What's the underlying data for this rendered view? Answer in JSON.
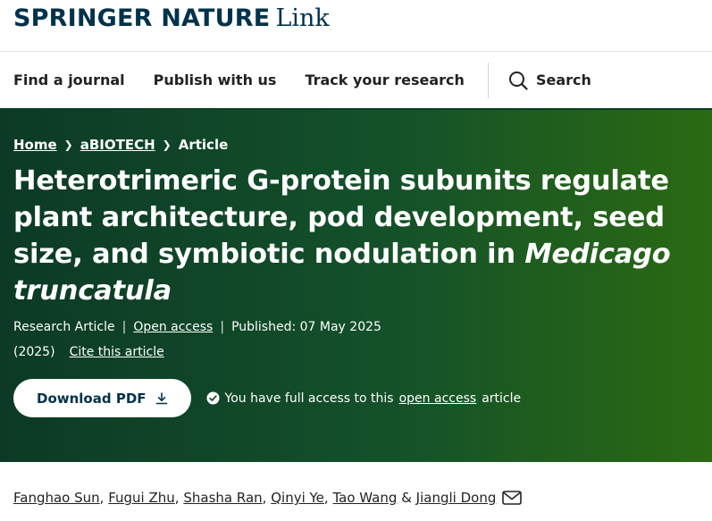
{
  "brand": {
    "main": "SPRINGER NATURE",
    "sub": "Link"
  },
  "nav": {
    "items": [
      "Find a journal",
      "Publish with us",
      "Track your research"
    ],
    "search_label": "Search"
  },
  "breadcrumb": {
    "home": "Home",
    "journal": "aBIOTECH",
    "current": "Article"
  },
  "article": {
    "title_main": "Heterotrimeric G-protein subunits regulate plant architecture, pod development, seed size, and symbiotic nodulation in ",
    "title_species": "Medicago truncatula",
    "type": "Research Article",
    "open_access": "Open access",
    "published": "Published: 07 May 2025",
    "year": "(2025)",
    "cite": "Cite this article"
  },
  "download": {
    "label": "Download PDF"
  },
  "access": {
    "prefix": "You have full access to this",
    "link": "open access",
    "suffix": "article"
  },
  "authors": {
    "names": [
      "Fanghao Sun",
      "Fugui Zhu",
      "Shasha Ran",
      "Qinyi Ye",
      "Tao Wang",
      "Jiangli Dong"
    ],
    "comma": ",",
    "amp": "&"
  },
  "colors": {
    "hero_start": "#0c3a26",
    "hero_end": "#2b6a12",
    "brand": "#01324b"
  },
  "icons": [
    "search-icon",
    "chevron-right-icon",
    "download-icon",
    "check-circle-icon",
    "envelope-icon"
  ]
}
